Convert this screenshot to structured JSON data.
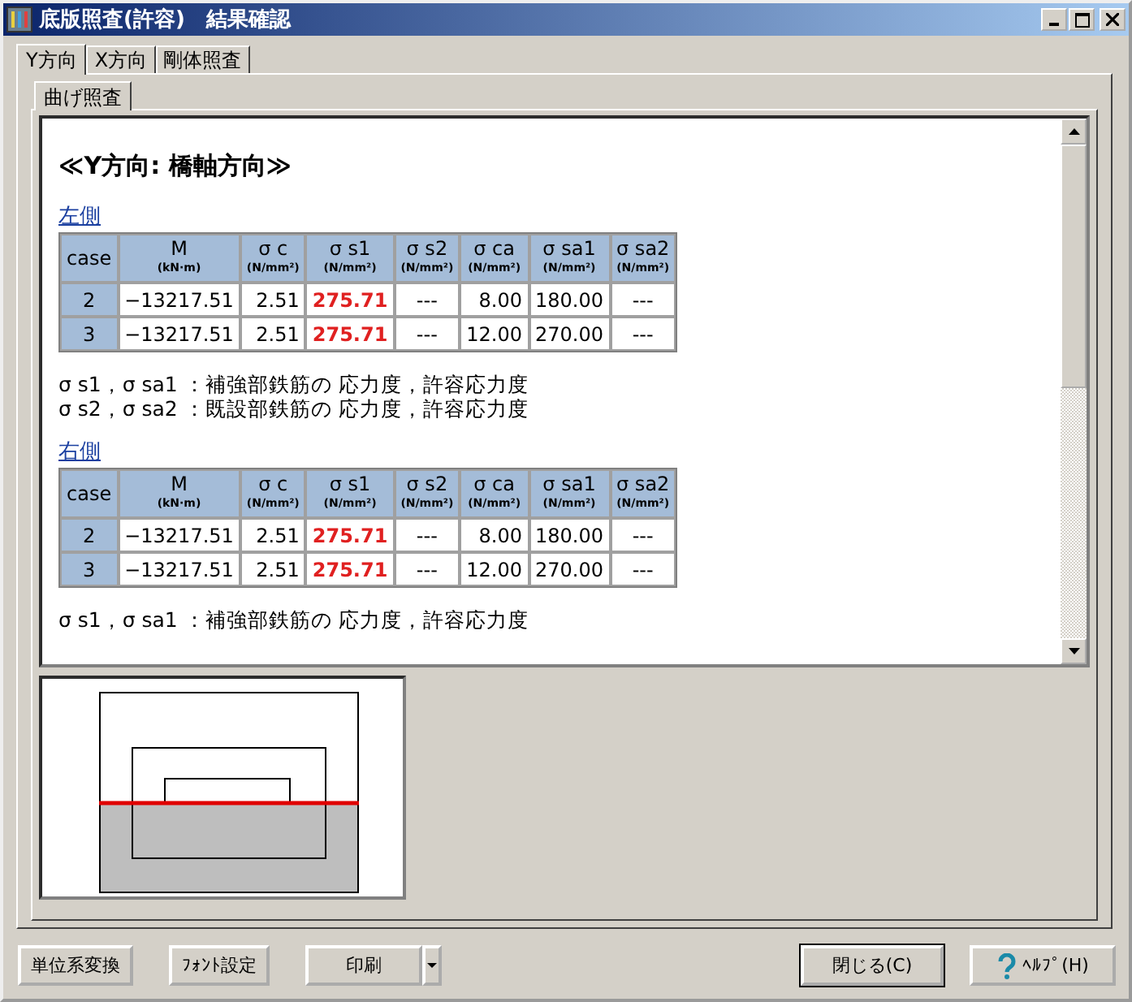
{
  "window": {
    "title": "底版照査(許容)　結果確認"
  },
  "tabs": [
    {
      "label": "Y方向",
      "selected": true
    },
    {
      "label": "X方向",
      "selected": false
    },
    {
      "label": "剛体照査",
      "selected": false
    }
  ],
  "subtabs": [
    {
      "label": "曲げ照査",
      "selected": true
    }
  ],
  "content": {
    "heading": "≪Y方向: 橋軸方向≫",
    "sections": [
      {
        "title": "左側",
        "columns": [
          {
            "label": "case"
          },
          {
            "label": "M",
            "unit": "(kN·m)"
          },
          {
            "label": "σ c",
            "unit": "(N/mm²)"
          },
          {
            "label": "σ s1",
            "unit": "(N/mm²)"
          },
          {
            "label": "σ s2",
            "unit": "(N/mm²)"
          },
          {
            "label": "σ ca",
            "unit": "(N/mm²)"
          },
          {
            "label": "σ sa1",
            "unit": "(N/mm²)"
          },
          {
            "label": "σ sa2",
            "unit": "(N/mm²)"
          }
        ],
        "rows": [
          {
            "cells": [
              {
                "text": "2",
                "over": false
              },
              {
                "text": "−13217.51",
                "over": false
              },
              {
                "text": "2.51",
                "over": false
              },
              {
                "text": "275.71",
                "over": true
              },
              {
                "text": "---",
                "over": false
              },
              {
                "text": "8.00",
                "over": false
              },
              {
                "text": "180.00",
                "over": false
              },
              {
                "text": "---",
                "over": false
              }
            ]
          },
          {
            "cells": [
              {
                "text": "3",
                "over": false
              },
              {
                "text": "−13217.51",
                "over": false
              },
              {
                "text": "2.51",
                "over": false
              },
              {
                "text": "275.71",
                "over": true
              },
              {
                "text": "---",
                "over": false
              },
              {
                "text": "12.00",
                "over": false
              },
              {
                "text": "270.00",
                "over": false
              },
              {
                "text": "---",
                "over": false
              }
            ]
          }
        ],
        "notes": [
          "σ s1，σ sa1 ：補強部鉄筋の 応力度，許容応力度",
          "σ s2，σ sa2 ：既設部鉄筋の 応力度，許容応力度"
        ]
      },
      {
        "title": "右側",
        "columns": [
          {
            "label": "case"
          },
          {
            "label": "M",
            "unit": "(kN·m)"
          },
          {
            "label": "σ c",
            "unit": "(N/mm²)"
          },
          {
            "label": "σ s1",
            "unit": "(N/mm²)"
          },
          {
            "label": "σ s2",
            "unit": "(N/mm²)"
          },
          {
            "label": "σ ca",
            "unit": "(N/mm²)"
          },
          {
            "label": "σ sa1",
            "unit": "(N/mm²)"
          },
          {
            "label": "σ sa2",
            "unit": "(N/mm²)"
          }
        ],
        "rows": [
          {
            "cells": [
              {
                "text": "2",
                "over": false
              },
              {
                "text": "−13217.51",
                "over": false
              },
              {
                "text": "2.51",
                "over": false
              },
              {
                "text": "275.71",
                "over": true
              },
              {
                "text": "---",
                "over": false
              },
              {
                "text": "8.00",
                "over": false
              },
              {
                "text": "180.00",
                "over": false
              },
              {
                "text": "---",
                "over": false
              }
            ]
          },
          {
            "cells": [
              {
                "text": "3",
                "over": false
              },
              {
                "text": "−13217.51",
                "over": false
              },
              {
                "text": "2.51",
                "over": false
              },
              {
                "text": "275.71",
                "over": true
              },
              {
                "text": "---",
                "over": false
              },
              {
                "text": "12.00",
                "over": false
              },
              {
                "text": "270.00",
                "over": false
              },
              {
                "text": "---",
                "over": false
              }
            ]
          }
        ],
        "notes": [
          "σ s1，σ sa1 ：補強部鉄筋の 応力度，許容応力度"
        ]
      }
    ]
  },
  "buttons": [
    {
      "label": "単位系変換",
      "kind": "plain"
    },
    {
      "label": "ﾌｫﾝﾄ設定",
      "kind": "plain"
    },
    {
      "label": "印刷",
      "kind": "split"
    },
    {
      "label": "閉じる(C)",
      "kind": "default"
    },
    {
      "label": "ﾍﾙﾌﾟ(H)",
      "kind": "help"
    }
  ]
}
